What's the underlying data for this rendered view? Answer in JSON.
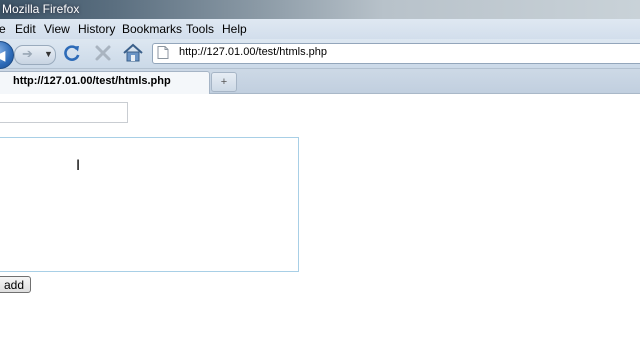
{
  "window": {
    "title": "Mozilla Firefox"
  },
  "menubar": {
    "items": [
      "e",
      "Edit",
      "View",
      "History",
      "Bookmarks",
      "Tools",
      "Help"
    ]
  },
  "navbar": {
    "back_icon": "back-arrow-icon",
    "forward_icon": "forward-arrow-icon",
    "reload_icon": "reload-icon",
    "stop_icon": "stop-icon",
    "home_icon": "home-icon",
    "url": "http://127.01.00/test/htmls.php"
  },
  "tabs": {
    "active_title": "http://127.01.00/test/htmls.php",
    "new_tab_label": "+"
  },
  "form": {
    "text_value": "",
    "textarea_value": "",
    "submit_label": "add"
  },
  "colors": {
    "accent": "#2d6bb8",
    "textarea_border": "#a8cfe6"
  }
}
